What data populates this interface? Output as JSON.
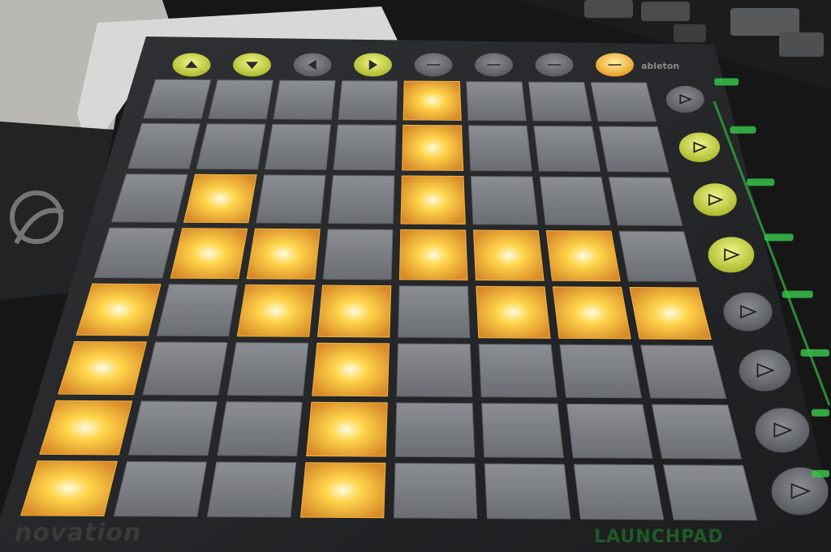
{
  "device": {
    "brand": "novation",
    "model": "LAUNCHPAD",
    "logo_maker": "ableton"
  },
  "colors": {
    "pad_lit": "#f7c640",
    "pad_off": "#7c7f84",
    "button_green": "#c9d43a",
    "button_amber": "#f5b83a",
    "button_off": "#5e6166",
    "indicator_green": "#36c24a"
  },
  "top_buttons": [
    {
      "icon": "up-arrow-icon",
      "state": "green"
    },
    {
      "icon": "down-arrow-icon",
      "state": "green"
    },
    {
      "icon": "left-arrow-icon",
      "state": "off"
    },
    {
      "icon": "right-arrow-icon",
      "state": "green"
    },
    {
      "icon": "session-icon",
      "state": "off"
    },
    {
      "icon": "user1-icon",
      "state": "off"
    },
    {
      "icon": "user2-icon",
      "state": "off"
    },
    {
      "icon": "mixer-icon",
      "state": "amber"
    }
  ],
  "side_buttons": [
    {
      "icon": "play-icon",
      "state": "off"
    },
    {
      "icon": "play-icon",
      "state": "green"
    },
    {
      "icon": "play-icon",
      "state": "green"
    },
    {
      "icon": "play-icon",
      "state": "green"
    },
    {
      "icon": "play-icon",
      "state": "off"
    },
    {
      "icon": "play-icon",
      "state": "off"
    },
    {
      "icon": "play-icon",
      "state": "off"
    },
    {
      "icon": "play-icon",
      "state": "off"
    }
  ],
  "pads": [
    [
      0,
      0,
      0,
      0,
      1,
      0,
      0,
      0
    ],
    [
      0,
      0,
      0,
      0,
      1,
      0,
      0,
      0
    ],
    [
      0,
      1,
      0,
      0,
      1,
      0,
      0,
      0
    ],
    [
      0,
      1,
      1,
      0,
      1,
      1,
      1,
      0
    ],
    [
      1,
      0,
      1,
      1,
      0,
      1,
      1,
      1
    ],
    [
      1,
      0,
      0,
      1,
      0,
      0,
      0,
      0
    ],
    [
      1,
      0,
      0,
      1,
      0,
      0,
      0,
      0
    ],
    [
      1,
      0,
      0,
      1,
      0,
      0,
      0,
      0
    ]
  ]
}
